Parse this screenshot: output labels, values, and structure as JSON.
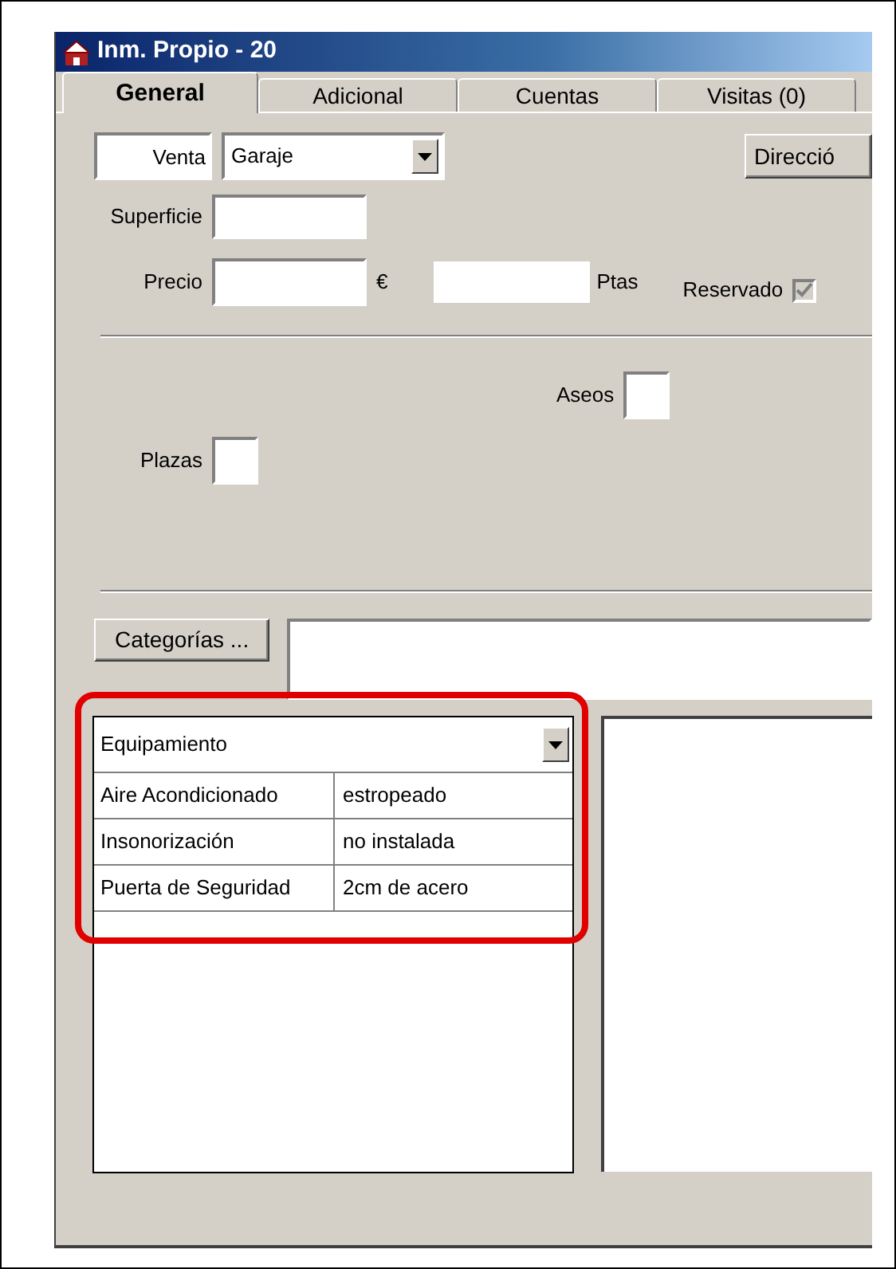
{
  "window": {
    "title": "Inm. Propio - 20"
  },
  "tabs": [
    {
      "label": "General",
      "selected": true
    },
    {
      "label": "Adicional",
      "selected": false
    },
    {
      "label": "Cuentas",
      "selected": false
    },
    {
      "label": "Visitas (0)",
      "selected": false
    }
  ],
  "operation_field": {
    "value": "Venta"
  },
  "type_combo": {
    "value": "Garaje"
  },
  "address_button": {
    "label": "Direcció"
  },
  "surface": {
    "label": "Superficie"
  },
  "price": {
    "label": "Precio",
    "currency": "€",
    "alt_currency": "Ptas"
  },
  "reserved": {
    "label": "Reservado",
    "checked": true,
    "disabled": true
  },
  "toilets": {
    "label": "Aseos"
  },
  "spaces": {
    "label": "Plazas"
  },
  "categories_button": {
    "label": "Categorías ..."
  },
  "equipment": {
    "selector": "Equipamiento",
    "rows": [
      {
        "name": "Aire Acondicionado",
        "value": "estropeado"
      },
      {
        "name": "Insonorización",
        "value": "no instalada"
      },
      {
        "name": "Puerta de Seguridad",
        "value": "2cm de acero"
      }
    ]
  }
}
